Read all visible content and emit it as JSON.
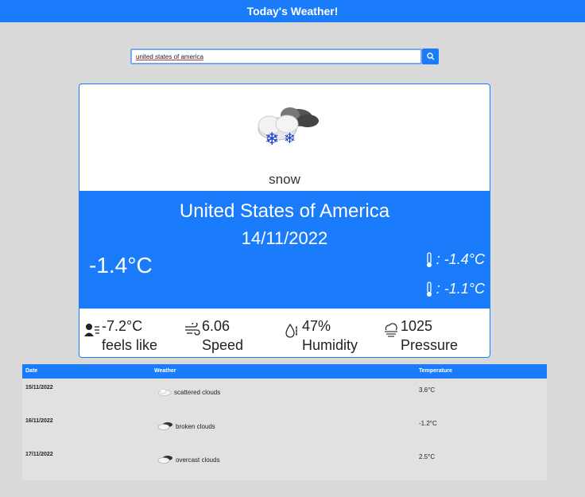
{
  "header": {
    "title": "Today's Weather!"
  },
  "search": {
    "value": "united states of america",
    "button_icon": "search-icon"
  },
  "current": {
    "condition": "snow",
    "condition_icon": "snow-cloud-icon",
    "city": "United States of America",
    "date": "14/11/2022",
    "temperature": "-1.4°C",
    "temp_max": ": -1.4°C",
    "temp_min": ": -1.1°C",
    "feels_like_value": "-7.2°C",
    "feels_like_label": "feels like",
    "wind_value": "6.06",
    "wind_label": "Speed",
    "humidity_value": "47%",
    "humidity_label": "Humidity",
    "pressure_value": "1025",
    "pressure_label": "Pressure"
  },
  "forecast": {
    "headers": {
      "date": "Date",
      "weather": "Weather",
      "temperature": "Temperature"
    },
    "rows": [
      {
        "date": "15/11/2022",
        "weather": "scattered clouds",
        "temperature": "3.6°C"
      },
      {
        "date": "16/11/2022",
        "weather": "broken clouds",
        "temperature": "-1.2°C"
      },
      {
        "date": "17/11/2022",
        "weather": "overcast clouds",
        "temperature": "2.5°C"
      }
    ]
  },
  "colors": {
    "accent": "#1a7cfa",
    "background": "#d9d9d9",
    "table_bg": "#e1e1e1"
  }
}
